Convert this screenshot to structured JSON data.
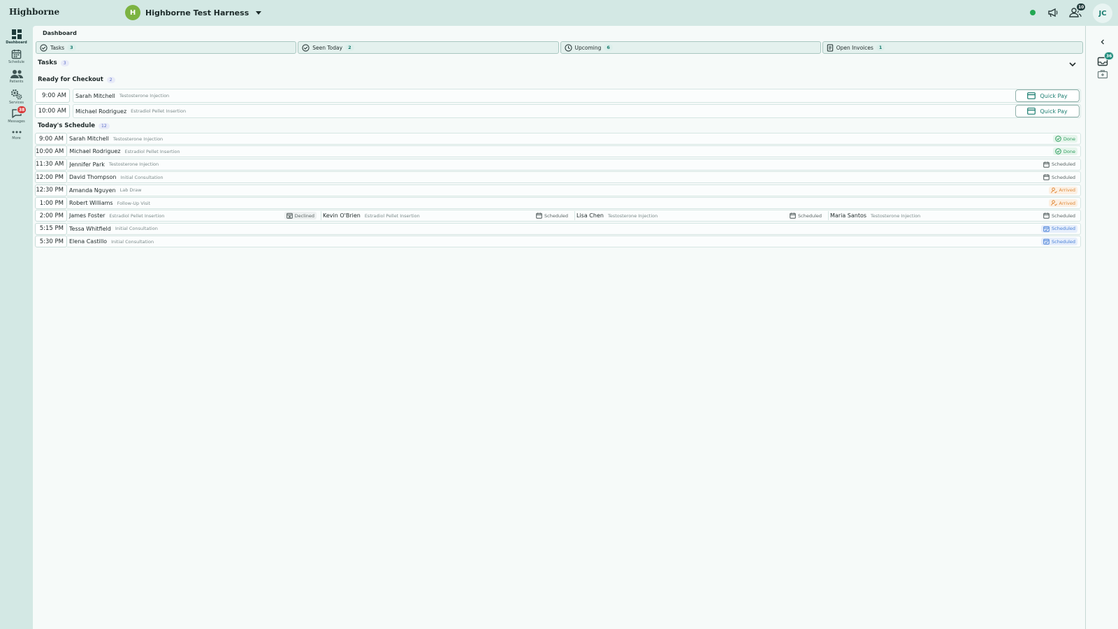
{
  "header": {
    "brand": "Highborne",
    "org_initial": "H",
    "org_name": "Highborne Test Harness",
    "notif_badge": "10",
    "user_initials": "JC",
    "colors": {
      "accent": "#1b7d70",
      "status_online": "#22a852",
      "org_avatar": "#7cb342"
    }
  },
  "sidebar": {
    "items": [
      {
        "label": "Dashboard",
        "icon": "dashboard-icon",
        "active": true
      },
      {
        "label": "Schedule",
        "icon": "calendar-icon"
      },
      {
        "label": "Patients",
        "icon": "people-icon"
      },
      {
        "label": "Services",
        "icon": "gears-icon"
      },
      {
        "label": "Messages",
        "icon": "chat-icon",
        "badge": "38"
      },
      {
        "label": "More",
        "icon": "more-dots-icon"
      }
    ]
  },
  "main": {
    "breadcrumb": "Dashboard",
    "tabs": [
      {
        "label": "Tasks",
        "count": "3",
        "icon": "check-circle-icon"
      },
      {
        "label": "Seen Today",
        "count": "2",
        "icon": "check-circle-icon"
      },
      {
        "label": "Upcoming",
        "count": "6",
        "icon": "clock-icon"
      },
      {
        "label": "Open Invoices",
        "count": "1",
        "icon": "invoice-icon"
      }
    ],
    "tasks": {
      "title": "Tasks",
      "count": "3",
      "checkout": {
        "title": "Ready for Checkout",
        "count": "2",
        "quick_pay_label": "Quick Pay",
        "rows": [
          {
            "time": "9:00 AM",
            "name": "Sarah Mitchell",
            "type": "Testosterone Injection"
          },
          {
            "time": "10:00 AM",
            "name": "Michael Rodriguez",
            "type": "Estradiol Pellet Insertion"
          }
        ]
      },
      "schedule": {
        "title": "Today's Schedule",
        "count": "12",
        "rows": [
          {
            "time": "9:00 AM",
            "appts": [
              {
                "name": "Sarah Mitchell",
                "type": "Testosterone Injection",
                "status": "Done",
                "kind": "done"
              }
            ]
          },
          {
            "time": "10:00 AM",
            "appts": [
              {
                "name": "Michael Rodriguez",
                "type": "Estradiol Pellet Insertion",
                "status": "Done",
                "kind": "done"
              }
            ]
          },
          {
            "time": "11:30 AM",
            "appts": [
              {
                "name": "Jennifer Park",
                "type": "Testosterone Injection",
                "status": "Scheduled",
                "kind": "scheduled"
              }
            ]
          },
          {
            "time": "12:00 PM",
            "appts": [
              {
                "name": "David Thompson",
                "type": "Initial Consultation",
                "status": "Scheduled",
                "kind": "scheduled"
              }
            ]
          },
          {
            "time": "12:30 PM",
            "appts": [
              {
                "name": "Amanda Nguyen",
                "type": "Lab Draw",
                "status": "Arrived",
                "kind": "arrived"
              }
            ]
          },
          {
            "time": "1:00 PM",
            "appts": [
              {
                "name": "Robert Williams",
                "type": "Follow-Up Visit",
                "status": "Arrived",
                "kind": "arrived"
              }
            ]
          },
          {
            "time": "2:00 PM",
            "appts": [
              {
                "name": "James Foster",
                "type": "Estradiol Pellet Insertion",
                "status": "Declined",
                "kind": "declined"
              },
              {
                "name": "Kevin O'Brien",
                "type": "Estradiol Pellet Insertion",
                "status": "Scheduled",
                "kind": "scheduled"
              },
              {
                "name": "Lisa Chen",
                "type": "Testosterone Injection",
                "status": "Scheduled",
                "kind": "scheduled"
              },
              {
                "name": "Maria Santos",
                "type": "Testosterone Injection",
                "status": "Scheduled",
                "kind": "scheduled"
              }
            ]
          },
          {
            "time": "5:15 PM",
            "appts": [
              {
                "name": "Tessa Whitfield",
                "type": "Initial Consultation",
                "status": "Scheduled",
                "kind": "confirmed"
              }
            ]
          },
          {
            "time": "5:30 PM",
            "appts": [
              {
                "name": "Elena Castillo",
                "type": "Initial Consultation",
                "status": "Scheduled",
                "kind": "confirmed"
              }
            ]
          }
        ]
      }
    }
  },
  "rightrail": {
    "inbox_badge": "36"
  }
}
